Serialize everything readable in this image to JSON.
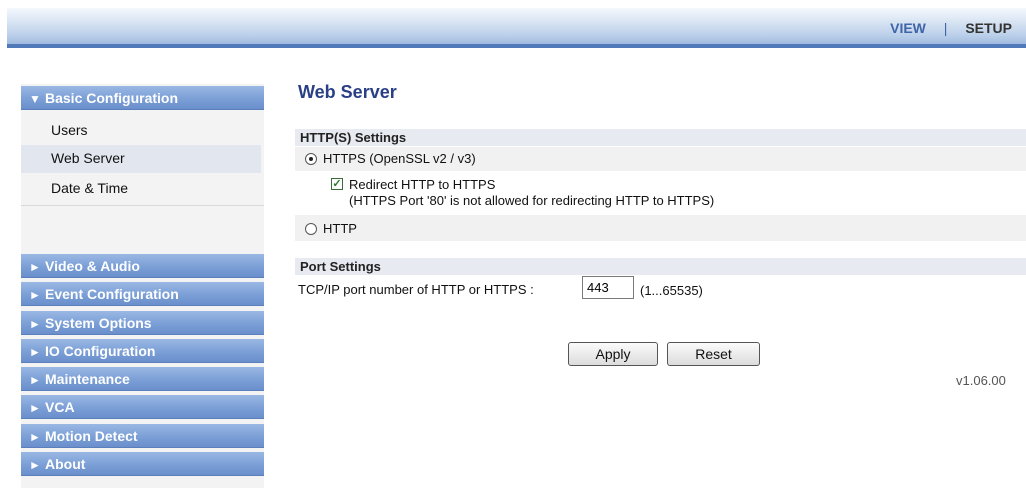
{
  "topnav": {
    "view": "VIEW",
    "separator": "|",
    "setup": "SETUP"
  },
  "sidebar": {
    "basic": {
      "label": "Basic Configuration",
      "arrow": "▼",
      "items": [
        "Users",
        "Web Server",
        "Date & Time"
      ],
      "active_item": "Web Server"
    },
    "menus": [
      {
        "label": "Video & Audio",
        "arrow": "►"
      },
      {
        "label": "Event Configuration",
        "arrow": "►"
      },
      {
        "label": "System Options",
        "arrow": "►"
      },
      {
        "label": "IO Configuration",
        "arrow": "►"
      },
      {
        "label": "Maintenance",
        "arrow": "►"
      },
      {
        "label": "VCA",
        "arrow": "►"
      },
      {
        "label": "Motion Detect",
        "arrow": "►"
      },
      {
        "label": "About",
        "arrow": "►"
      }
    ]
  },
  "main": {
    "title": "Web Server",
    "http_settings": {
      "heading": "HTTP(S) Settings",
      "https_option": "HTTPS (OpenSSL v2 / v3)",
      "https_selected": true,
      "redirect_label": "Redirect HTTP to HTTPS",
      "redirect_checked": true,
      "redirect_note": "(HTTPS Port '80' is not allowed for redirecting HTTP to HTTPS)",
      "http_option": "HTTP",
      "http_selected": false
    },
    "port_settings": {
      "heading": "Port Settings",
      "label": "TCP/IP port number of HTTP or HTTPS :",
      "value": "443",
      "range": "(1...65535)"
    },
    "buttons": {
      "apply": "Apply",
      "reset": "Reset"
    },
    "version": "v1.06.00"
  },
  "colors": {
    "accent": "#3f64a8",
    "menu_blue": "#7b9fd6",
    "title_color": "#2a3f86"
  }
}
